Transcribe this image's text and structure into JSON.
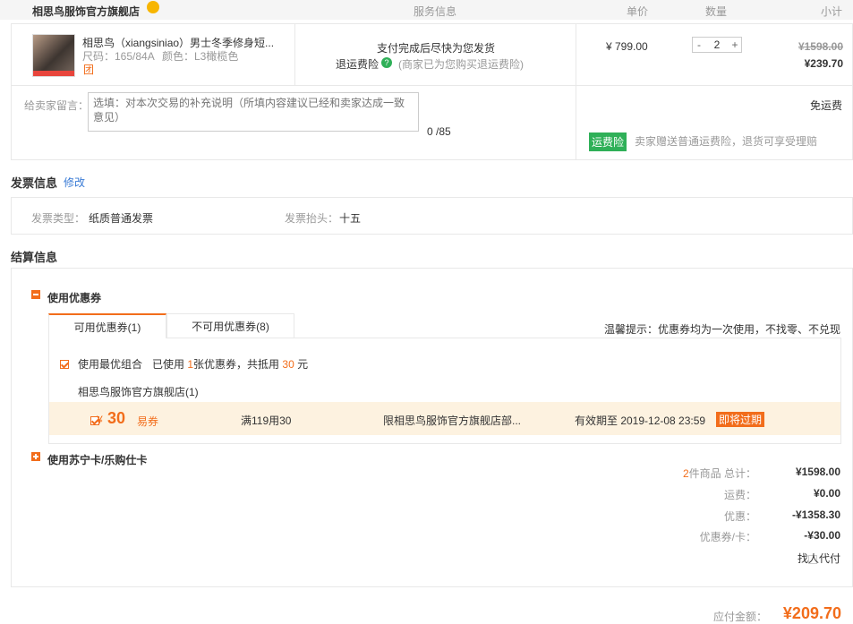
{
  "shop": {
    "name": "相思鸟服饰官方旗舰店",
    "name_short": "相思鸟服饰官方旗舰店(1)"
  },
  "headers": {
    "service": "服务信息",
    "unit_price": "单价",
    "quantity": "数量",
    "subtotal": "小计"
  },
  "item": {
    "title": "相思鸟（xiangsiniao）男士冬季修身短...",
    "size": "尺码：165/84A",
    "color": "颜色：L3橄榄色",
    "extra": "团",
    "service_line1": "支付完成后尽快为您发货",
    "return_ins": "退运费险",
    "return_ins_note": "(商家已为您购买退运费险)",
    "price": "¥ 799.00",
    "qty": "2",
    "minus": "-",
    "plus": "+",
    "subtotal_original": "¥1598.00",
    "subtotal": "¥239.70"
  },
  "message": {
    "label": "给卖家留言：",
    "placeholder": "选填：对本次交易的补充说明（所填内容建议已经和卖家达成一致意见）",
    "count": "0 /85"
  },
  "shipping": {
    "free": "免运费",
    "ins_badge": "运费险",
    "ins_note": "卖家赠送普通运费险，退货可享受理赔"
  },
  "invoice": {
    "title": "发票信息",
    "edit": "修改",
    "type_label": "发票类型：",
    "type_value": "纸质普通发票",
    "head_label": "发票抬头：",
    "head_value": "十五"
  },
  "settlement": {
    "title": "结算信息",
    "coupon_section": "使用优惠券",
    "tab_available": "可用优惠券(1)",
    "tab_unavailable": "不可用优惠券(8)",
    "tip": "温馨提示：优惠券均为一次使用，不找零、不兑现",
    "best_combo": "使用最优组合",
    "used_pre": "已使用",
    "used_count": "1",
    "used_mid": "张优惠券，共抵用",
    "used_amount": "30",
    "used_suf": "元",
    "coupon": {
      "symbol": "¥",
      "amount": "30",
      "type": "易券",
      "rule": "满119用30",
      "scope": "限相思鸟服饰官方旗舰店部...",
      "expiry": "有效期至 2019-12-08 23:59",
      "expiring_badge": "即将过期"
    },
    "card_section": "使用苏宁卡/乐购仕卡"
  },
  "summary": {
    "count": "2",
    "count_suffix": "件商品 总计：",
    "total": "¥1598.00",
    "shipping_label": "运费：",
    "shipping": "¥0.00",
    "discount_label": "优惠：",
    "discount": "-¥1358.30",
    "coupon_label": "优惠券/卡：",
    "coupon": "-¥30.00",
    "proxy_pay": "找人代付",
    "payable_label": "应付金额：",
    "payable": "¥209.70"
  },
  "colors": {
    "accent": "#f26d1b",
    "green": "#2fb058"
  }
}
